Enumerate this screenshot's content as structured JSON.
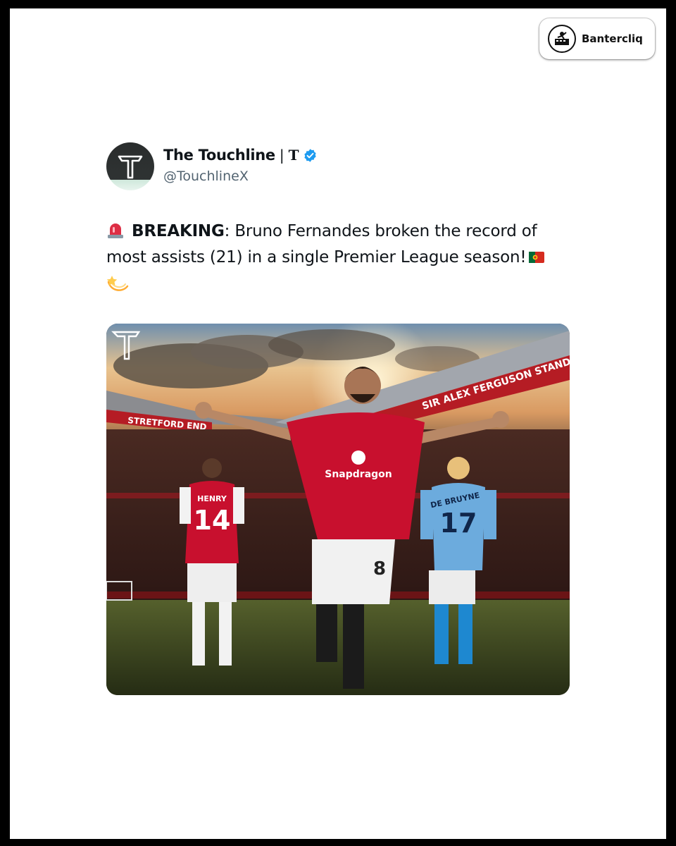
{
  "badge": {
    "label": "Bantercliq",
    "icon": "bantercliq-logo-icon"
  },
  "tweet": {
    "display_name": "The Touchline",
    "name_separator": "|",
    "name_suffix": "T",
    "handle": "@TouchlineX",
    "verified": true,
    "verified_color": "#1d9bf0",
    "text_lead": "BREAKING",
    "text_colon": ":",
    "text_body": " Bruno Fernandes broken the record of most assists (21) in a single Premier League season!",
    "emojis": [
      "police-car-light-icon",
      "portugal-flag-icon",
      "dizzy-icon"
    ]
  },
  "media": {
    "watermark": "T",
    "stand_left": "STRETFORD END",
    "stand_right": "SIR ALEX FERGUSON STAND",
    "player_left": {
      "name": "HENRY",
      "number": "14"
    },
    "player_center": {
      "sponsor": "Snapdragon",
      "number": "8"
    },
    "player_right": {
      "name": "DE BRUYNE",
      "number": "17"
    }
  },
  "colors": {
    "text": "#0f1419",
    "secondary": "#536471",
    "united_red": "#c8102e",
    "city_blue": "#6cabdd"
  }
}
